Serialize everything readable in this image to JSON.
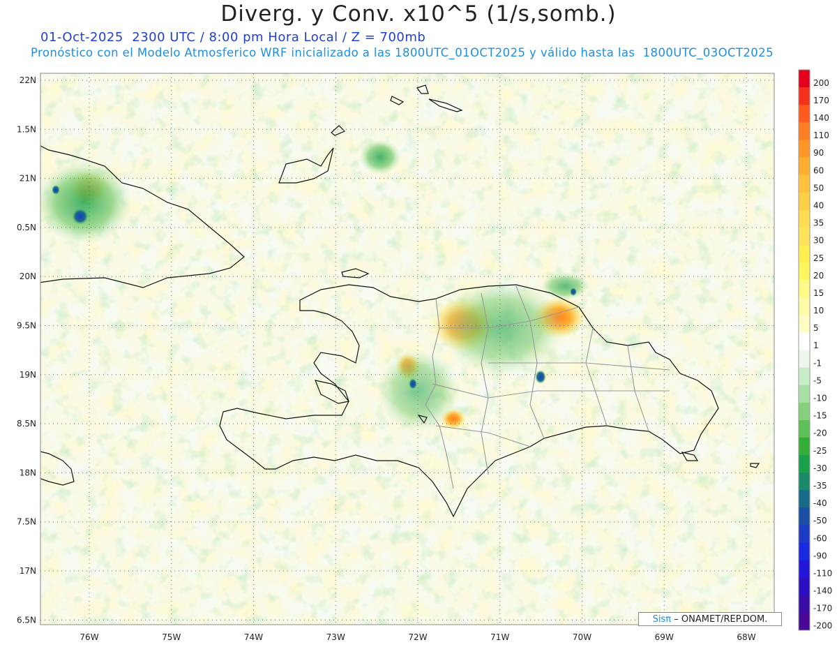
{
  "header": {
    "title": "Diverg. y Conv. x10^5 (1/s,somb.)",
    "datetime_line": "01-Oct-2025  2300 UTC / 8:00 pm Hora Local / Z = 700mb",
    "model_line": "Pronóstico con el Modelo Atmosferico WRF inicializado a las 1800UTC_01OCT2025 y válido hasta las  1800UTC_03OCT2025"
  },
  "map": {
    "lon_labels": [
      "76W",
      "75W",
      "74W",
      "73W",
      "72W",
      "71W",
      "70W",
      "69W",
      "68W"
    ],
    "lat_labels": [
      "22N",
      "1.5N",
      "21N",
      "0.5N",
      "20N",
      "9.5N",
      "19N",
      "8.5N",
      "18N",
      "7.5N",
      "17N",
      "6.5N"
    ],
    "grid": "dotted"
  },
  "colorbar": {
    "levels": [
      "200",
      "170",
      "140",
      "110",
      "90",
      "60",
      "50",
      "40",
      "35",
      "30",
      "25",
      "20",
      "15",
      "10",
      "5",
      "1",
      "-1",
      "-5",
      "-10",
      "-15",
      "-20",
      "-25",
      "-30",
      "-35",
      "-40",
      "-50",
      "-60",
      "-90",
      "-110",
      "-140",
      "-170",
      "-200"
    ],
    "colors": [
      "#e4001c",
      "#f5301a",
      "#ff5a1e",
      "#ff7d22",
      "#ff9628",
      "#ffae2e",
      "#ffc23a",
      "#ffd046",
      "#ffdc50",
      "#ffe45a",
      "#ffee4e",
      "#fff55c",
      "#fff988",
      "#fffca8",
      "#fffdc4",
      "#ffffff",
      "#eef7ee",
      "#c8ecc6",
      "#a8dfa2",
      "#86d07c",
      "#5cbf58",
      "#32ad35",
      "#19a04a",
      "#1b8a6a",
      "#176b88",
      "#1c4fa4",
      "#1c3cc8",
      "#1a2ae0",
      "#2216d8",
      "#2a10c0",
      "#3a0ca8",
      "#4a0898"
    ]
  },
  "credit": {
    "brand": "Sisπ",
    "text": "– ONAMET/REP.DOM."
  }
}
